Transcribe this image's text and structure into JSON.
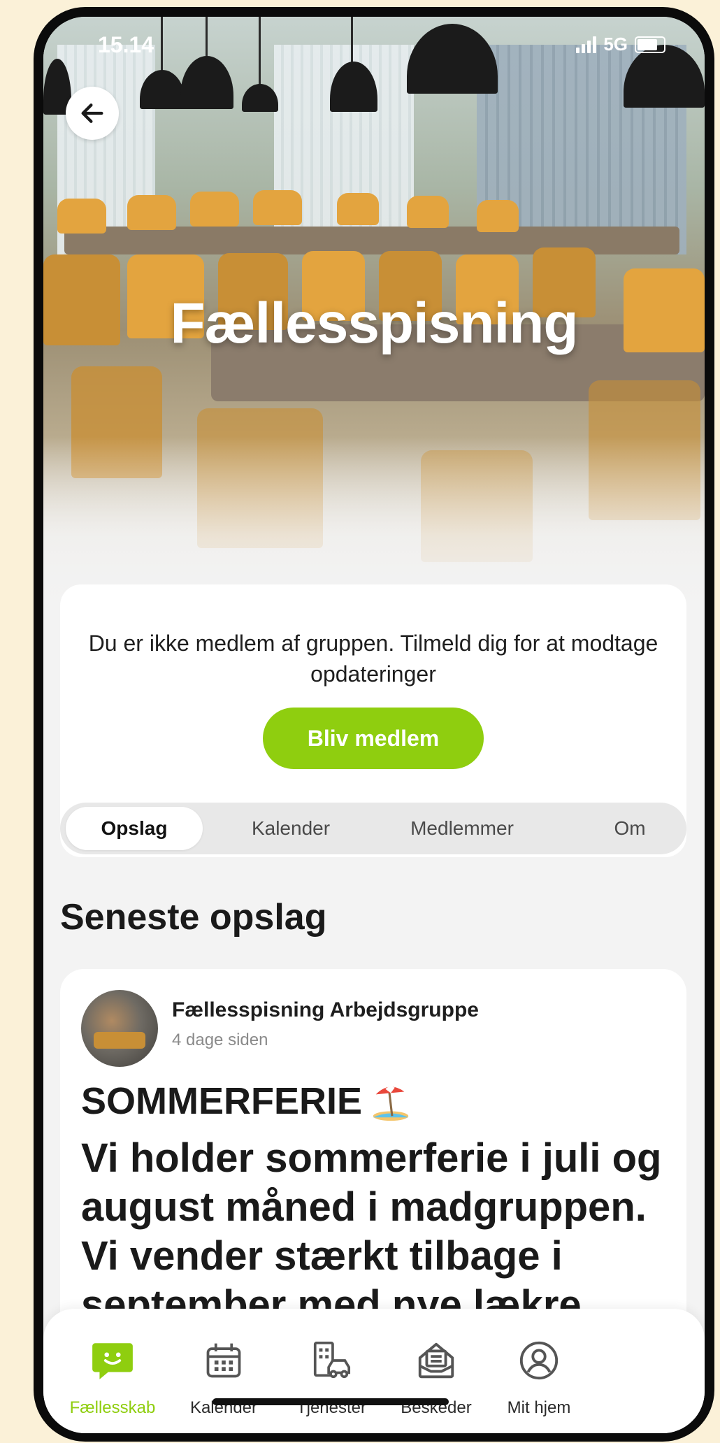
{
  "status": {
    "time": "15.14",
    "network": "5G"
  },
  "hero": {
    "title": "Fællesspisning"
  },
  "join": {
    "message": "Du er ikke medlem af gruppen. Tilmeld dig for at modtage opdateringer",
    "button_label": "Bliv medlem"
  },
  "tabs": [
    {
      "label": "Opslag",
      "active": true
    },
    {
      "label": "Kalender",
      "active": false
    },
    {
      "label": "Medlemmer",
      "active": false
    },
    {
      "label": "Om",
      "active": false
    }
  ],
  "section": {
    "title": "Seneste opslag"
  },
  "post": {
    "author": "Fællesspisning Arbejdsgruppe",
    "time": "4 dage siden",
    "headline": "SOMMERFERIE",
    "body": "Vi holder sommerferie i juli og august måned i madgruppen. Vi vender stærkt tilbage i september med nye lækre"
  },
  "bottom_nav": [
    {
      "label": "Fællesskab",
      "icon": "chat-bubble-icon",
      "active": true
    },
    {
      "label": "Kalender",
      "icon": "calendar-icon",
      "active": false
    },
    {
      "label": "Tjenester",
      "icon": "building-car-icon",
      "active": false
    },
    {
      "label": "Beskeder",
      "icon": "inbox-icon",
      "active": false
    },
    {
      "label": "Mit hjem",
      "icon": "user-icon",
      "active": false
    }
  ],
  "colors": {
    "accent": "#8fce0f",
    "background": "#f3f3f3",
    "frame": "#fbf1d8"
  }
}
